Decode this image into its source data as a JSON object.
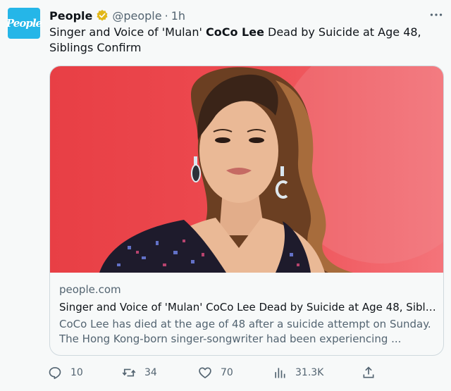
{
  "author": {
    "avatar_text": "People",
    "name": "People",
    "handle": "@people",
    "separator": "·",
    "time": "1h",
    "verified_icon": "gold-verified-badge"
  },
  "menu_icon": "more-dots-icon",
  "tweet": {
    "text_before": "Singer and Voice of 'Mulan' ",
    "text_bold": "CoCo Lee",
    "text_after": " Dead by Suicide at Age 48, Siblings Confirm"
  },
  "card": {
    "domain": "people.com",
    "title": "Singer and Voice of 'Mulan' CoCo Lee Dead by Suicide at Age 48, Sibli...",
    "description": "CoCo Lee has died at the age of 48 after a suicide attempt on Sunday. The Hong Kong-born singer-songwriter had been experiencing ..."
  },
  "actions": {
    "reply_count": "10",
    "retweet_count": "34",
    "like_count": "70",
    "views_count": "31.3K"
  },
  "colors": {
    "avatar_bg": "#25b6e8",
    "verified_gold": "#e2b719",
    "muted_text": "#536471",
    "card_border": "#cfd9de",
    "image_red": "#e83f45"
  }
}
